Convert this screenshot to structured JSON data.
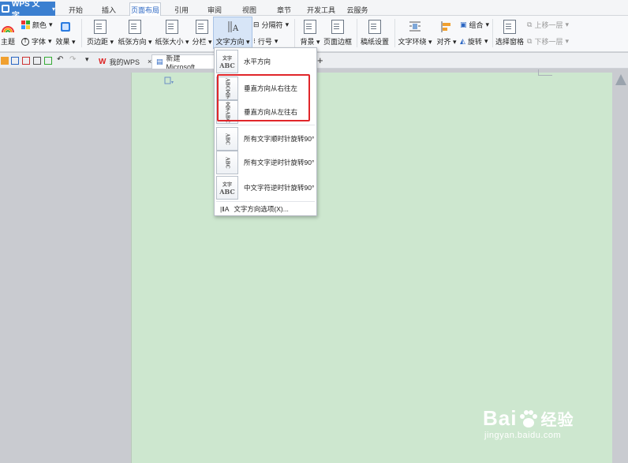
{
  "app": {
    "name": "WPS 文字"
  },
  "menu_tabs": [
    {
      "label": "开始"
    },
    {
      "label": "插入"
    },
    {
      "label": "页面布局"
    },
    {
      "label": "引用"
    },
    {
      "label": "审阅"
    },
    {
      "label": "视图"
    },
    {
      "label": "章节"
    },
    {
      "label": "开发工具"
    },
    {
      "label": "云服务"
    }
  ],
  "ribbon": {
    "theme": "主题",
    "colors": "颜色",
    "font": "字体",
    "effects": "效果",
    "margins": "页边距",
    "orientation": "纸张方向",
    "size": "纸张大小",
    "columns": "分栏",
    "text_direction": "文字方向",
    "breaks": "分隔符",
    "line_numbers": "行号",
    "background": "背景",
    "page_border": "页面边框",
    "manuscript": "稿纸设置",
    "text_wrap": "文字环绕",
    "align": "对齐",
    "group": "组合",
    "rotate": "旋转",
    "select_pane": "选择窗格",
    "bring_forward": "上移一层",
    "send_backward": "下移一层"
  },
  "doc_tabs": [
    {
      "label": "我的WPS"
    },
    {
      "label": "新建 Microsoft"
    }
  ],
  "dropdown": {
    "items": [
      {
        "label": "水平方向",
        "icon": "text-horizontal-icon"
      },
      {
        "label": "垂直方向从右往左",
        "icon": "text-vertical-rtl-icon"
      },
      {
        "label": "垂直方向从左往右",
        "icon": "text-vertical-ltr-icon"
      },
      {
        "label": "所有文字顺时针旋转90°",
        "icon": "rotate-cw-icon"
      },
      {
        "label": "所有文字逆时针旋转90°",
        "icon": "rotate-ccw-icon"
      },
      {
        "label": "中文字符逆时针旋转90°",
        "icon": "cjk-rotate-icon"
      }
    ],
    "options_label": "文字方向选项(X)...",
    "icon_texts": {
      "wen_zi": "文字",
      "abc": "ABC"
    }
  },
  "watermark": {
    "brand": "Bai",
    "brand_suffix": "经验",
    "url": "jingyan.baidu.com"
  },
  "colors": {
    "accent": "#3b7fd0",
    "page": "#cde7cf",
    "highlight": "#e0262a"
  }
}
